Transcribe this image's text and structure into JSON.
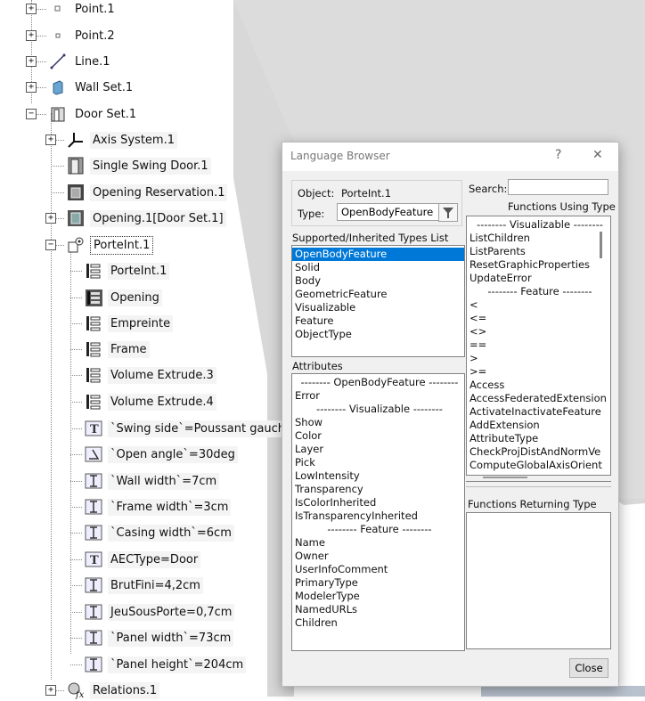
{
  "tree": {
    "nodes": [
      {
        "label": "Point.1"
      },
      {
        "label": "Point.2"
      },
      {
        "label": "Line.1"
      },
      {
        "label": "Wall Set.1"
      },
      {
        "label": "Door Set.1"
      },
      {
        "label": "Axis System.1"
      },
      {
        "label": "Single Swing Door.1"
      },
      {
        "label": "Opening Reservation.1"
      },
      {
        "label": "Opening.1[Door Set.1]"
      },
      {
        "label": "PorteInt.1"
      },
      {
        "label": "PorteInt.1"
      },
      {
        "label": "Opening"
      },
      {
        "label": "Empreinte"
      },
      {
        "label": "Frame"
      },
      {
        "label": "Volume Extrude.3"
      },
      {
        "label": "Volume Extrude.4"
      },
      {
        "label": "`Swing side`=Poussant gauche"
      },
      {
        "label": "`Open angle`=30deg"
      },
      {
        "label": "`Wall width`=7cm"
      },
      {
        "label": "`Frame width`=3cm"
      },
      {
        "label": "`Casing width`=6cm"
      },
      {
        "label": "AECType=Door"
      },
      {
        "label": "BrutFini=4,2cm"
      },
      {
        "label": "JeuSousPorte=0,7cm"
      },
      {
        "label": "`Panel width`=73cm"
      },
      {
        "label": "`Panel height`=204cm"
      },
      {
        "label": "Relations.1"
      }
    ]
  },
  "dialog": {
    "title": "Language Browser",
    "help": "?",
    "close_glyph": "✕",
    "object_label": "Object:",
    "object_value": "PorteInt.1",
    "type_label": "Type:",
    "type_value": "OpenBodyFeature",
    "search_label": "Search:",
    "search_value": "",
    "supported_header": "Supported/Inherited Types List",
    "supported": [
      "OpenBodyFeature",
      "Solid",
      "Body",
      "GeometricFeature",
      "Visualizable",
      "Feature",
      "ObjectType"
    ],
    "attributes_header": "Attributes",
    "attributes": [
      "-------- OpenBodyFeature --------",
      "Error",
      "-------- Visualizable --------",
      "Show",
      "Color",
      "Layer",
      "Pick",
      "LowIntensity",
      "Transparency",
      "IsColorInherited",
      "IsTransparencyInherited",
      "-------- Feature --------",
      "Name",
      "Owner",
      "UserInfoComment",
      "PrimaryType",
      "ModelerType",
      "NamedURLs",
      "Children"
    ],
    "functions_using_header": "Functions Using Type",
    "functions_using": [
      "-------- Visualizable --------",
      "ListChildren",
      "ListParents",
      "ResetGraphicProperties",
      "UpdateError",
      "-------- Feature --------",
      "<",
      "<=",
      "<>",
      "==",
      ">",
      ">=",
      "Access",
      "AccessFederatedExtension",
      "ActivateInactivateFeature",
      "AddExtension",
      "AttributeType",
      "CheckProjDistAndNormVe",
      "ComputeGlobalAxisOrient"
    ],
    "functions_returning_header": "Functions Returning Type",
    "close_button": "Close"
  },
  "colors": {
    "selection": "#0078d7",
    "viewport_grey": "#dcdcdc"
  }
}
